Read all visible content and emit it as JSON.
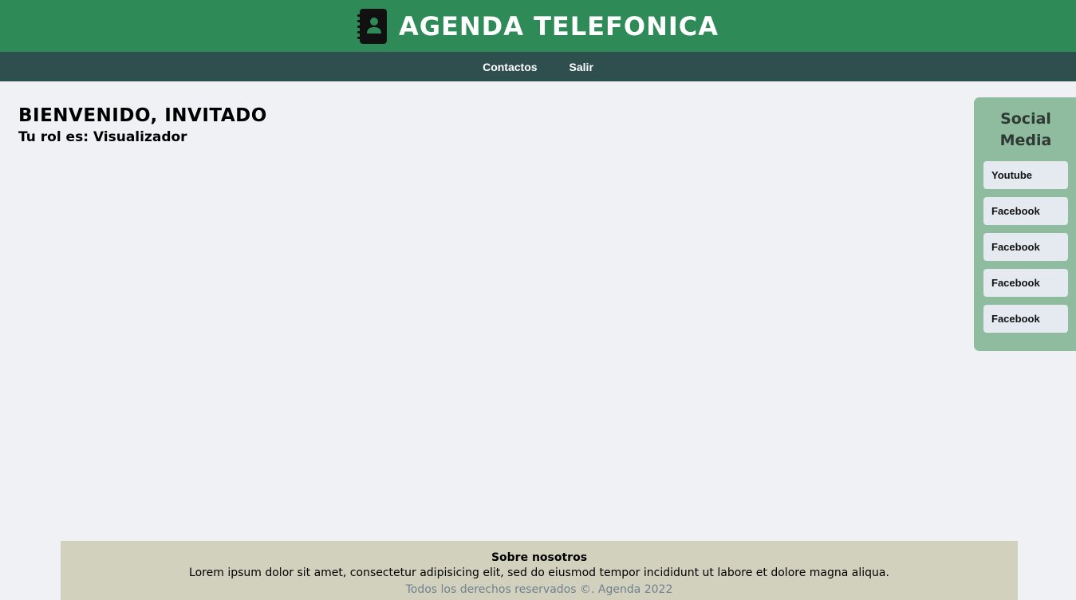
{
  "header": {
    "title": "AGENDA TELEFONICA",
    "logo_icon": "address-book-icon",
    "bg_color": "#2e8b57"
  },
  "nav": {
    "items": [
      {
        "label": "Contactos"
      },
      {
        "label": "Salir"
      }
    ],
    "bg_color": "#2f4f4f"
  },
  "welcome": {
    "heading": "BIENVENIDO, INVITADO",
    "role": "Tu rol es: Visualizador"
  },
  "social": {
    "title_line1": "Social",
    "title_line2": "Media",
    "links": [
      {
        "label": "Youtube"
      },
      {
        "label": "Facebook"
      },
      {
        "label": "Facebook"
      },
      {
        "label": "Facebook"
      },
      {
        "label": "Facebook"
      }
    ],
    "bg_color": "#8fbc9f"
  },
  "footer": {
    "about_title": "Sobre nosotros",
    "about_text": "Lorem ipsum dolor sit amet, consectetur adipisicing elit, sed do eiusmod tempor incididunt ut labore et dolore magna aliqua.",
    "copyright": "Todos los derechos reservados ©. Agenda 2022",
    "bg_color": "#d2d1bd"
  }
}
